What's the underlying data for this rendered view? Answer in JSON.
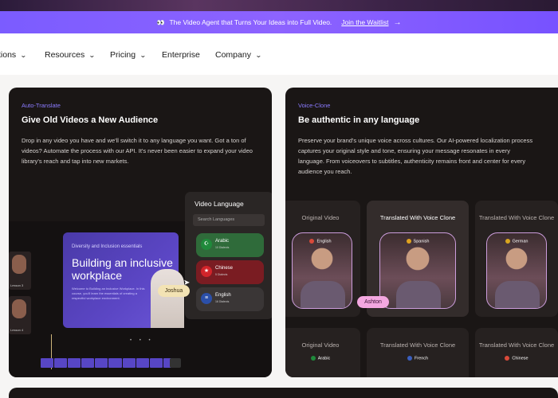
{
  "banner": {
    "emoji": "👀",
    "text": "The Video Agent that Turns Your Ideas into Full Video.",
    "link": "Join the Waitlist",
    "arrow": "→"
  },
  "nav": {
    "items": [
      {
        "label": "tions",
        "has_dropdown": true
      },
      {
        "label": "Resources",
        "has_dropdown": true
      },
      {
        "label": "Pricing",
        "has_dropdown": true
      },
      {
        "label": "Enterprise",
        "has_dropdown": false
      },
      {
        "label": "Company",
        "has_dropdown": true
      }
    ]
  },
  "auto_translate": {
    "eyebrow": "Auto-Translate",
    "title": "Give Old Videos a New Audience",
    "description": "Drop in any video you have and we'll switch it to any language you want. Got a ton of videos? Automate the process with our API. It's never been easier to expand your video library's reach and tap into new markets.",
    "slide": {
      "kicker": "Diversity and Inclusion essentials",
      "heading": "Building an inclusive workplace",
      "body": "Welcome to Building an Inclusive Workplace. In this course, you'll learn the essentials of creating a respectful workplace environment."
    },
    "thumbs": [
      "Lesson 3",
      "Lesson 4"
    ],
    "language_panel": {
      "title": "Video Language",
      "search_placeholder": "Search Languages",
      "languages": [
        {
          "name": "Arabic",
          "sub": "10 Dialects",
          "color": "#2f6b3a",
          "flag_color": "#1f8a3b"
        },
        {
          "name": "Chinese",
          "sub": "5 Dialects",
          "color": "#7a1c22",
          "flag_color": "#d1242a"
        },
        {
          "name": "English",
          "sub": "16 Dialects",
          "color": "#3a3636",
          "flag_color": "#2b4fa8"
        }
      ]
    },
    "cursor_name": "Joshua"
  },
  "voice_clone": {
    "eyebrow": "Voice-Clone",
    "title": "Be authentic in any language",
    "description": "Preserve your brand's unique voice across cultures. Our AI-powered localization process captures your original style and tone, ensuring your message resonates in every language. From voiceovers to subtitles, authenticity remains front and center for every audience you reach.",
    "row1": [
      {
        "label": "Original Video",
        "lang": "English",
        "highlight": false
      },
      {
        "label": "Translated With Voice Clone",
        "lang": "Spanish",
        "highlight": true
      },
      {
        "label": "Translated With Voice Clone",
        "lang": "German",
        "highlight": false
      }
    ],
    "row2": [
      {
        "label": "Original Video",
        "lang": "Arabic"
      },
      {
        "label": "Translated With Voice Clone",
        "lang": "French"
      },
      {
        "label": "Translated With Voice Clone",
        "lang": "Chinese"
      }
    ],
    "cursor_name": "Ashton"
  }
}
